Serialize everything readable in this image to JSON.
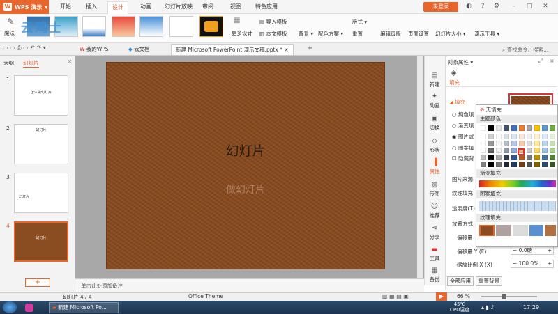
{
  "app": {
    "name": "WPS 演示",
    "login": "未登录"
  },
  "menu": [
    "开始",
    "插入",
    "设计",
    "动画",
    "幻灯片放映",
    "审阅",
    "视图",
    "特色应用"
  ],
  "ribbon": {
    "magic": "魔法",
    "more_design": "更多设计",
    "import_template": "导入模板",
    "text_template": "本文模板",
    "background": "背景",
    "color_scheme": "配色方案",
    "layout": "版式",
    "reset": "重置",
    "edit_master": "编辑母版",
    "page_setup": "页面设置",
    "slide_size": "幻灯片大小",
    "presentation_tools": "演示工具",
    "watermark": "云鸡士"
  },
  "tabs": {
    "my_wps": "我的WPS",
    "cloud_docs": "云文档",
    "current": "新建 Microsoft PowerPoint 演示文稿.pptx *",
    "search": "查找命令、搜索..."
  },
  "panel": {
    "outline": "大纲",
    "slides": "幻灯片"
  },
  "thumbs": [
    {
      "num": "1",
      "text": "怎么做幻灯片"
    },
    {
      "num": "2",
      "text": "幻灯片"
    },
    {
      "num": "3",
      "text": "幻灯片"
    },
    {
      "num": "4",
      "text": "幻灯片"
    }
  ],
  "slide": {
    "title": "幻灯片",
    "subtitle": "做幻灯片"
  },
  "sidebar": [
    "新建",
    "动画",
    "切换",
    "形状",
    "属性",
    "传图",
    "推荐",
    "分享",
    "工具",
    "备份"
  ],
  "props": {
    "title": "对象属性",
    "tab_fill": "填充",
    "fill": "填充",
    "solid": "纯色填",
    "gradient": "渐变填",
    "picture": "图片或",
    "pattern": "图案填",
    "hide_bg": "隐藏背",
    "picture_source": "图片来源",
    "texture": "纹理填充",
    "transparency": "透明度(T)",
    "placement": "放置方式",
    "offset_x": "偏移量",
    "offset_y": "偏移量 Y (E)",
    "offset_y_val": "0.0磅",
    "scale_x": "缩放比例 X (X)",
    "scale_x_val": "100.0%",
    "apply_all": "全部应用",
    "reset_bg": "重置背景"
  },
  "popup": {
    "no_fill": "无填充",
    "theme_colors": "主题颜色",
    "gradient_fill": "渐变填充",
    "pattern_fill": "图案填充",
    "texture_fill": "纹理填充"
  },
  "status": {
    "slide": "幻灯片 4 / 4",
    "notes": "单击此处添加备注",
    "theme": "Office Theme",
    "zoom": "66 %"
  },
  "taskbar": {
    "app": "新建 Microsoft Po...",
    "temp": "45℃",
    "cpu": "CPU温度",
    "time": "17:29"
  },
  "colors": {
    "accent": "#e8652c",
    "texture": "#8a4d22"
  }
}
